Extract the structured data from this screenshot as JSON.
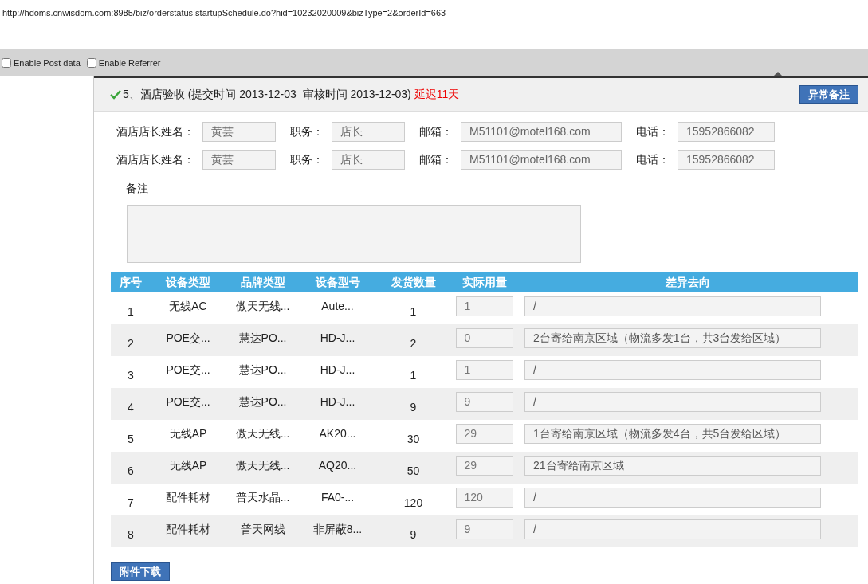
{
  "url": "http://hdoms.cnwisdom.com:8985/biz/orderstatus!startupSchedule.do?hid=10232020009&bizType=2&orderId=663",
  "toolbar": {
    "options": [
      {
        "label": "Enable Post data",
        "checked": false
      },
      {
        "label": "Enable Referrer",
        "checked": false
      }
    ]
  },
  "section": {
    "title": "5、酒店验收 (提交时间 2013-12-03  审核时间 2013-12-03)",
    "done": true,
    "delay": "延迟11天",
    "button": "异常备注"
  },
  "contacts": [
    [
      {
        "label": "酒店店长姓名：",
        "value": "黄芸"
      },
      {
        "label": "职务：",
        "value": "店长"
      },
      {
        "label": "邮箱：",
        "value": "M51101@motel168.com"
      },
      {
        "label": "电话：",
        "value": "15952866082"
      }
    ],
    [
      {
        "label": "酒店店长姓名：",
        "value": "黄芸"
      },
      {
        "label": "职务：",
        "value": "店长"
      },
      {
        "label": "邮箱：",
        "value": "M51101@motel168.com"
      },
      {
        "label": "电话：",
        "value": "15952866082"
      }
    ]
  ],
  "remark": {
    "label": "备注"
  },
  "table": {
    "columns": [
      "序号",
      "设备类型",
      "品牌类型",
      "设备型号",
      "发货数量",
      "实际用量",
      "差异去向"
    ],
    "rows": [
      {
        "cells": [
          "1",
          "无线AC",
          "傲天无线...",
          "Aute...",
          "1"
        ],
        "actual": "1",
        "note": "/"
      },
      {
        "cells": [
          "2",
          "POE交...",
          "慧达PO...",
          "HD-J...",
          "2"
        ],
        "actual": "0",
        "note": "2台寄给南京区域（物流多发1台，共3台发给区域）"
      },
      {
        "cells": [
          "3",
          "POE交...",
          "慧达PO...",
          "HD-J...",
          "1"
        ],
        "actual": "1",
        "note": "/"
      },
      {
        "cells": [
          "4",
          "POE交...",
          "慧达PO...",
          "HD-J...",
          "9"
        ],
        "actual": "9",
        "note": "/"
      },
      {
        "cells": [
          "5",
          "无线AP",
          "傲天无线...",
          "AK20...",
          "30"
        ],
        "actual": "29",
        "note": "1台寄给南京区域（物流多发4台，共5台发给区域）"
      },
      {
        "cells": [
          "6",
          "无线AP",
          "傲天无线...",
          "AQ20...",
          "50"
        ],
        "actual": "29",
        "note": "21台寄给南京区域"
      },
      {
        "cells": [
          "7",
          "配件耗材",
          "普天水晶...",
          "FA0-...",
          "120"
        ],
        "actual": "120",
        "note": "/"
      },
      {
        "cells": [
          "8",
          "配件耗材",
          "普天网线",
          "非屏蔽8...",
          "9"
        ],
        "actual": "9",
        "note": "/"
      }
    ]
  },
  "download_button": "附件下载"
}
